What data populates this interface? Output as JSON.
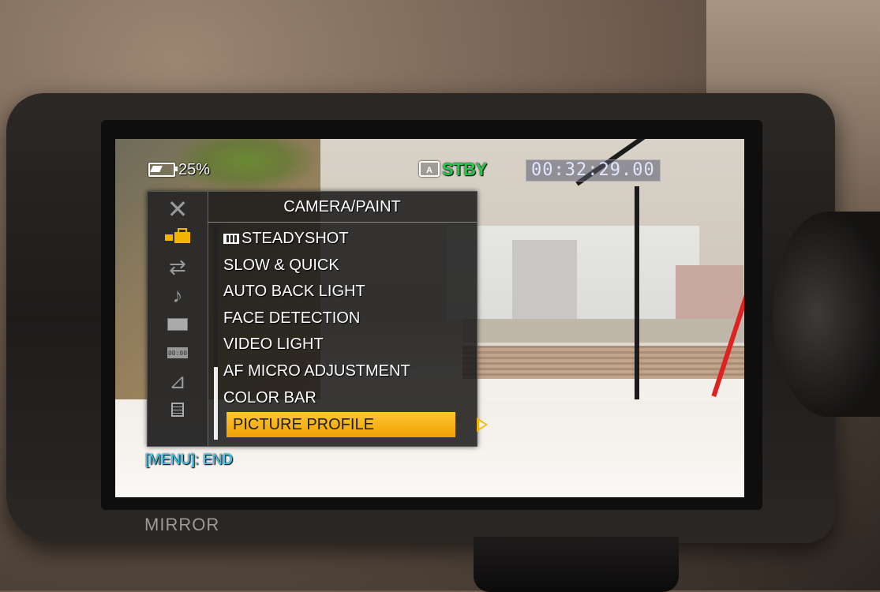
{
  "camera": {
    "brand_label": "MIRROR"
  },
  "status_bar": {
    "battery_text": "25%",
    "ca_icon_label": "A",
    "standby_text": "STBY",
    "timecode": "00:32:29.00"
  },
  "menu": {
    "title": "CAMERA/PAINT",
    "sidebar": {
      "close": "✕",
      "swap": "⇄",
      "audio": "♪",
      "timecode_icon": "00:00",
      "network": "⊿"
    },
    "items": [
      {
        "label": "STEADYSHOT",
        "icon": "film-icon"
      },
      {
        "label": "SLOW & QUICK"
      },
      {
        "label": "AUTO BACK LIGHT"
      },
      {
        "label": "FACE DETECTION"
      },
      {
        "label": "VIDEO LIGHT"
      },
      {
        "label": "AF MICRO ADJUSTMENT"
      },
      {
        "label": "COLOR BAR"
      },
      {
        "label": "PICTURE PROFILE",
        "selected": true
      }
    ],
    "footer": "[MENU]: END"
  },
  "colors": {
    "accent": "#f4b400",
    "standby": "#22c84a",
    "footer": "#2ad0ff"
  }
}
